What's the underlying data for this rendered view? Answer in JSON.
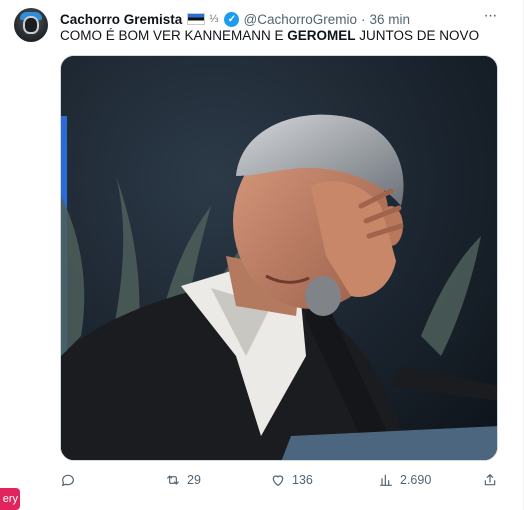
{
  "tweet": {
    "display_name": "Cachorro Gremista",
    "handle": "@CachorroGremio",
    "separator": "·",
    "time": "36 min",
    "text_part1": "COMO É BOM VER KANNEMANN E ",
    "text_bold": "GEROMEL",
    "text_part2": " JUNTOS DE NOVO",
    "media_alt": "Man in dark suit wiping his eye at a microphone"
  },
  "actions": {
    "replies": "",
    "retweets": "29",
    "likes": "136",
    "views": "2.690"
  },
  "overlay_badge": "ery",
  "icons": {
    "verified": "verified-badge-icon",
    "more": "more-options-icon",
    "reply": "reply-icon",
    "retweet": "retweet-icon",
    "like": "heart-icon",
    "views": "bar-chart-icon",
    "share": "share-icon"
  },
  "colors": {
    "accent": "#1d9bf0",
    "secondary_text": "#536471",
    "badge": "#e0245e"
  }
}
